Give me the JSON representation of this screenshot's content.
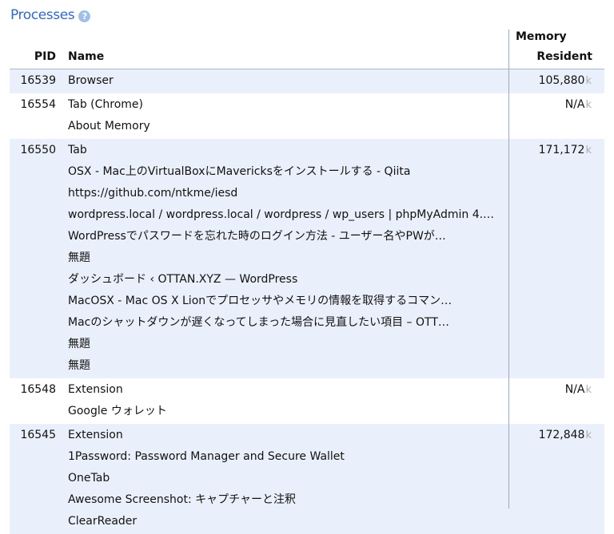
{
  "page": {
    "title": "Processes",
    "help_icon": "help-circle-icon",
    "help_glyph": "?"
  },
  "table": {
    "headers": {
      "pid": "PID",
      "name": "Name",
      "memory_group": "Memory",
      "resident": "Resident"
    },
    "unit": "k",
    "rows": [
      {
        "pid": "16539",
        "names": [
          "Browser"
        ],
        "resident": "105,880"
      },
      {
        "pid": "16554",
        "names": [
          "Tab (Chrome)",
          "About Memory"
        ],
        "resident": "N/A"
      },
      {
        "pid": "16550",
        "names": [
          "Tab",
          "OSX - Mac上のVirtualBoxにMavericksをインストールする - Qiita",
          "https://github.com/ntkme/iesd",
          "wordpress.local / wordpress.local / wordpress / wp_users | phpMyAdmin 4.…",
          "WordPressでパスワードを忘れた時のログイン方法 - ユーザー名やPWが…",
          "無題",
          "ダッシュボード ‹ OTTAN.XYZ — WordPress",
          "MacOSX - Mac OS X Lionでプロセッサやメモリの情報を取得するコマン…",
          "Macのシャットダウンが遅くなってしまった場合に見直したい項目 – OTT…",
          "無題",
          "無題"
        ],
        "resident": "171,172"
      },
      {
        "pid": "16548",
        "names": [
          "Extension",
          "Google ウォレット"
        ],
        "resident": "N/A"
      },
      {
        "pid": "16545",
        "names": [
          "Extension",
          "1Password: Password Manager and Secure Wallet",
          "OneTab",
          "Awesome Screenshot: キャプチャーと注釈",
          "ClearReader"
        ],
        "resident": "172,848"
      }
    ]
  }
}
